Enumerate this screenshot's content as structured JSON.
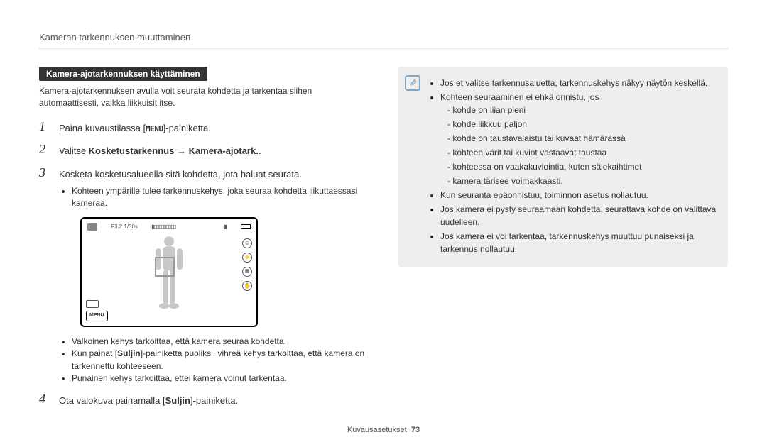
{
  "header": {
    "title": "Kameran tarkennuksen muuttaminen"
  },
  "left": {
    "sub_heading": "Kamera-ajotarkennuksen käyttäminen",
    "intro": "Kamera-ajotarkennuksen avulla voit seurata kohdetta ja tarkentaa siihen automaattisesti, vaikka liikkuisit itse.",
    "menu_glyph": "MENU",
    "steps": {
      "s1": {
        "num": "1",
        "pre": "Paina kuvaustilassa [",
        "post": "]-painiketta."
      },
      "s2": {
        "num": "2",
        "pre": "Valitse ",
        "b1": "Kosketustarkennus",
        "arrow": " → ",
        "b2": "Kamera-ajotark.",
        "post": "."
      },
      "s3": {
        "num": "3",
        "text": "Kosketa kosketusalueella sitä kohdetta, jota haluat seurata.",
        "sub": "Kohteen ympärille tulee tarkennuskehys, joka seuraa kohdetta liikuttaessasi kameraa."
      },
      "s4": {
        "num": "4",
        "pre": "Ota valokuva painamalla [",
        "b": "Suljin",
        "post": "]-painiketta."
      }
    },
    "after_screen_bullets": {
      "b1": "Valkoinen kehys tarkoittaa, että kamera seuraa kohdetta.",
      "b2_pre": "Kun painat [",
      "b2_b": "Suljin",
      "b2_post": "]-painiketta puoliksi, vihreä kehys tarkoittaa, että kamera on tarkennettu kohteeseen.",
      "b3": "Punainen kehys tarkoittaa, ettei kamera voinut tarkentaa."
    },
    "camera": {
      "exposure": "F3.2 1/30s",
      "menu_label": "MENU"
    }
  },
  "right": {
    "note": {
      "n1": "Jos et valitse tarkennusaluetta, tarkennuskehys näkyy näytön keskellä.",
      "n2": "Kohteen seuraaminen ei ehkä onnistu, jos",
      "sub": {
        "a": "kohde on liian pieni",
        "b": "kohde liikkuu paljon",
        "c": "kohde on taustavalaistu tai kuvaat hämärässä",
        "d": "kohteen värit tai kuviot vastaavat taustaa",
        "e": "kohteessa on vaakakuviointia, kuten sälekaihtimet",
        "f": "kamera tärisee voimakkaasti."
      },
      "n3": "Kun seuranta epäonnistuu, toiminnon asetus nollautuu.",
      "n4": "Jos kamera ei pysty seuraamaan kohdetta, seurattava kohde on valittava uudelleen.",
      "n5": "Jos kamera ei voi tarkentaa, tarkennuskehys muuttuu punaiseksi ja tarkennus nollautuu."
    }
  },
  "footer": {
    "section": "Kuvausasetukset",
    "page": "73"
  }
}
